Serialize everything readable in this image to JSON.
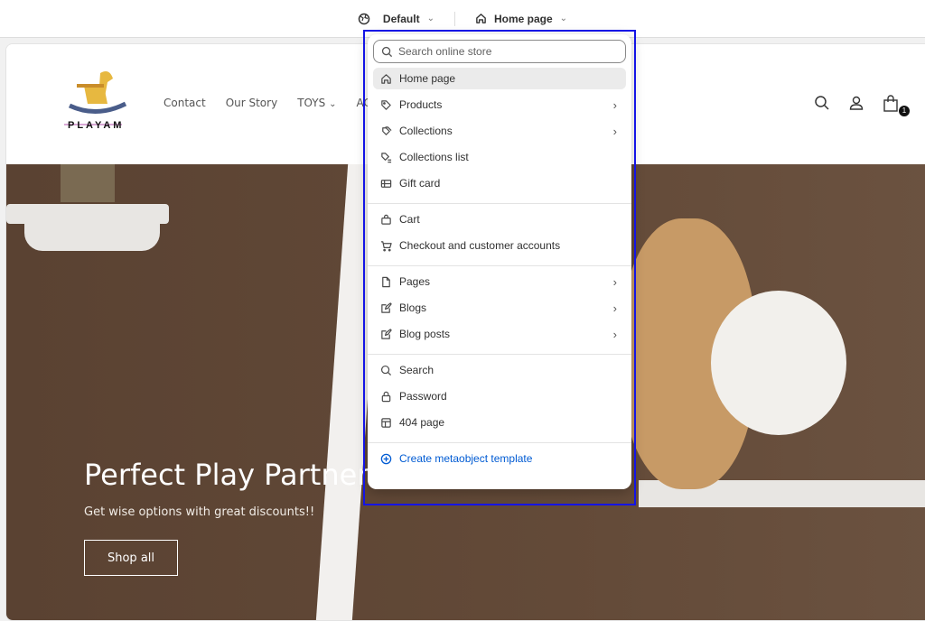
{
  "topbar": {
    "theme_label": "Default",
    "page_label": "Home page"
  },
  "store": {
    "logo_text": "PLAYAM",
    "nav": [
      "Contact",
      "Our Story",
      "TOYS",
      "ACTIV"
    ],
    "cart_count": "1",
    "hero": {
      "title": "Perfect Play Partner fo",
      "subtitle": "Get wise options with great discounts!!",
      "button": "Shop all"
    }
  },
  "dropdown": {
    "search_placeholder": "Search online store",
    "groups": [
      [
        {
          "label": "Home page",
          "icon": "home-icon",
          "active": true
        },
        {
          "label": "Products",
          "icon": "tag-icon",
          "arrow": true
        },
        {
          "label": "Collections",
          "icon": "collection-icon",
          "arrow": true
        },
        {
          "label": "Collections list",
          "icon": "collections-list-icon"
        },
        {
          "label": "Gift card",
          "icon": "gift-card-icon"
        }
      ],
      [
        {
          "label": "Cart",
          "icon": "bag-icon"
        },
        {
          "label": "Checkout and customer accounts",
          "icon": "cart-icon"
        }
      ],
      [
        {
          "label": "Pages",
          "icon": "page-icon",
          "arrow": true
        },
        {
          "label": "Blogs",
          "icon": "blog-icon",
          "arrow": true
        },
        {
          "label": "Blog posts",
          "icon": "blog-post-icon",
          "arrow": true
        }
      ],
      [
        {
          "label": "Search",
          "icon": "search-icon"
        },
        {
          "label": "Password",
          "icon": "lock-icon"
        },
        {
          "label": "404 page",
          "icon": "box-icon"
        }
      ]
    ],
    "create_label": "Create metaobject template",
    "accent": "#005bd3"
  }
}
